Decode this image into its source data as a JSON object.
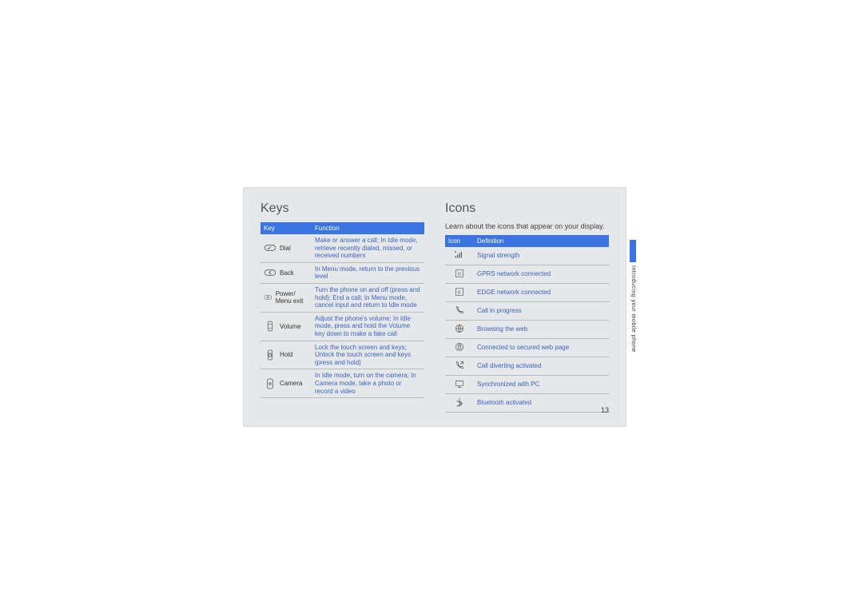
{
  "page_number": "13",
  "side_label": "Introducing your mobile phone",
  "keys": {
    "heading": "Keys",
    "col_key": "Key",
    "col_func": "Function",
    "rows": [
      {
        "icon": "dial-key-icon",
        "name": "Dial",
        "func": "Make or answer a call; In Idle mode, retrieve recently dialed, missed, or received numbers"
      },
      {
        "icon": "back-key-icon",
        "name": "Back",
        "func": "In Menu mode, return to the previous level"
      },
      {
        "icon": "power-key-icon",
        "name": "Power/ Menu exit",
        "func": "Turn the phone on and off (press and hold); End a call; In Menu mode, cancel input and return to Idle mode"
      },
      {
        "icon": "volume-key-icon",
        "name": "Volume",
        "func": "Adjust the phone's volume; In Idle mode, press and hold the Volume key down to make a fake call"
      },
      {
        "icon": "hold-key-icon",
        "name": "Hold",
        "func": "Lock the touch screen and keys; Unlock the touch screen and keys (press and hold)"
      },
      {
        "icon": "camera-key-icon",
        "name": "Camera",
        "func": "In Idle mode, turn on the camera; In Camera mode, take a photo or record a video"
      }
    ]
  },
  "icons": {
    "heading": "Icons",
    "intro": "Learn about the icons that appear on your display.",
    "col_icon": "Icon",
    "col_def": "Definition",
    "rows": [
      {
        "icon": "signal-icon",
        "def": "Signal strength"
      },
      {
        "icon": "gprs-icon",
        "def": "GPRS network connected"
      },
      {
        "icon": "edge-icon",
        "def": "EDGE network connected"
      },
      {
        "icon": "call-icon",
        "def": "Call in progress"
      },
      {
        "icon": "browsing-icon",
        "def": "Browsing the web"
      },
      {
        "icon": "secure-web-icon",
        "def": "Connected to secured web page"
      },
      {
        "icon": "divert-icon",
        "def": "Call diverting activated"
      },
      {
        "icon": "sync-pc-icon",
        "def": "Synchronized with PC"
      },
      {
        "icon": "bluetooth-icon",
        "def": "Bluetooth activated"
      }
    ]
  }
}
